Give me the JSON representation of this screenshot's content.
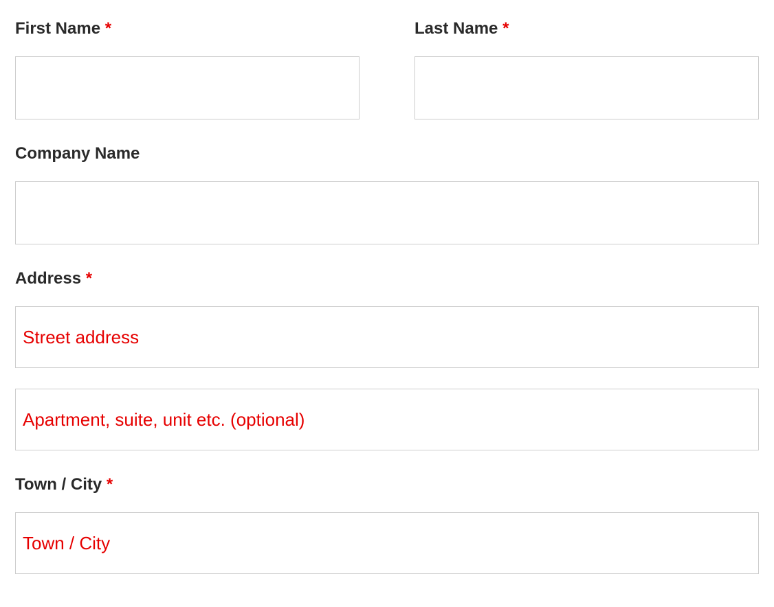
{
  "form": {
    "first_name": {
      "label": "First Name",
      "required": "*",
      "value": ""
    },
    "last_name": {
      "label": "Last Name",
      "required": "*",
      "value": ""
    },
    "company_name": {
      "label": "Company Name",
      "value": ""
    },
    "address": {
      "label": "Address",
      "required": "*",
      "street_placeholder": "Street address",
      "street_value": "",
      "apartment_placeholder": "Apartment, suite, unit etc. (optional)",
      "apartment_value": ""
    },
    "town_city": {
      "label": "Town / City",
      "required": "*",
      "placeholder": "Town / City",
      "value": ""
    }
  }
}
